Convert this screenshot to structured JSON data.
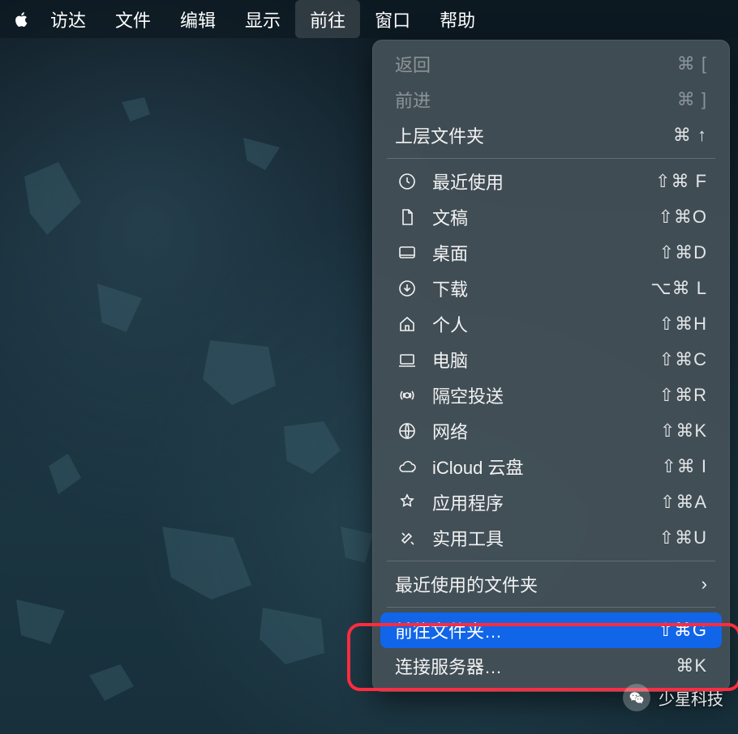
{
  "menubar": {
    "items": [
      "访达",
      "文件",
      "编辑",
      "显示",
      "前往",
      "窗口",
      "帮助"
    ],
    "active_index": 4
  },
  "menu": {
    "section1": [
      {
        "label": "返回",
        "shortcut": "⌘ [",
        "disabled": true
      },
      {
        "label": "前进",
        "shortcut": "⌘ ]",
        "disabled": true
      },
      {
        "label": "上层文件夹",
        "shortcut": "⌘ ↑",
        "disabled": false
      }
    ],
    "section2": [
      {
        "icon": "clock",
        "label": "最近使用",
        "shortcut": "⇧⌘ F"
      },
      {
        "icon": "document",
        "label": "文稿",
        "shortcut": "⇧⌘O"
      },
      {
        "icon": "desktop",
        "label": "桌面",
        "shortcut": "⇧⌘D"
      },
      {
        "icon": "download",
        "label": "下载",
        "shortcut": "⌥⌘ L"
      },
      {
        "icon": "home",
        "label": "个人",
        "shortcut": "⇧⌘H"
      },
      {
        "icon": "computer",
        "label": "电脑",
        "shortcut": "⇧⌘C"
      },
      {
        "icon": "airdrop",
        "label": "隔空投送",
        "shortcut": "⇧⌘R"
      },
      {
        "icon": "network",
        "label": "网络",
        "shortcut": "⇧⌘K"
      },
      {
        "icon": "cloud",
        "label": "iCloud 云盘",
        "shortcut": "⇧⌘ I"
      },
      {
        "icon": "apps",
        "label": "应用程序",
        "shortcut": "⇧⌘A"
      },
      {
        "icon": "tools",
        "label": "实用工具",
        "shortcut": "⇧⌘U"
      }
    ],
    "section3": {
      "label": "最近使用的文件夹"
    },
    "section4": [
      {
        "label": "前往文件夹…",
        "shortcut": "⇧⌘G",
        "highlight": true
      },
      {
        "label": "连接服务器…",
        "shortcut": "⌘K"
      }
    ]
  },
  "watermark": "少星科技"
}
